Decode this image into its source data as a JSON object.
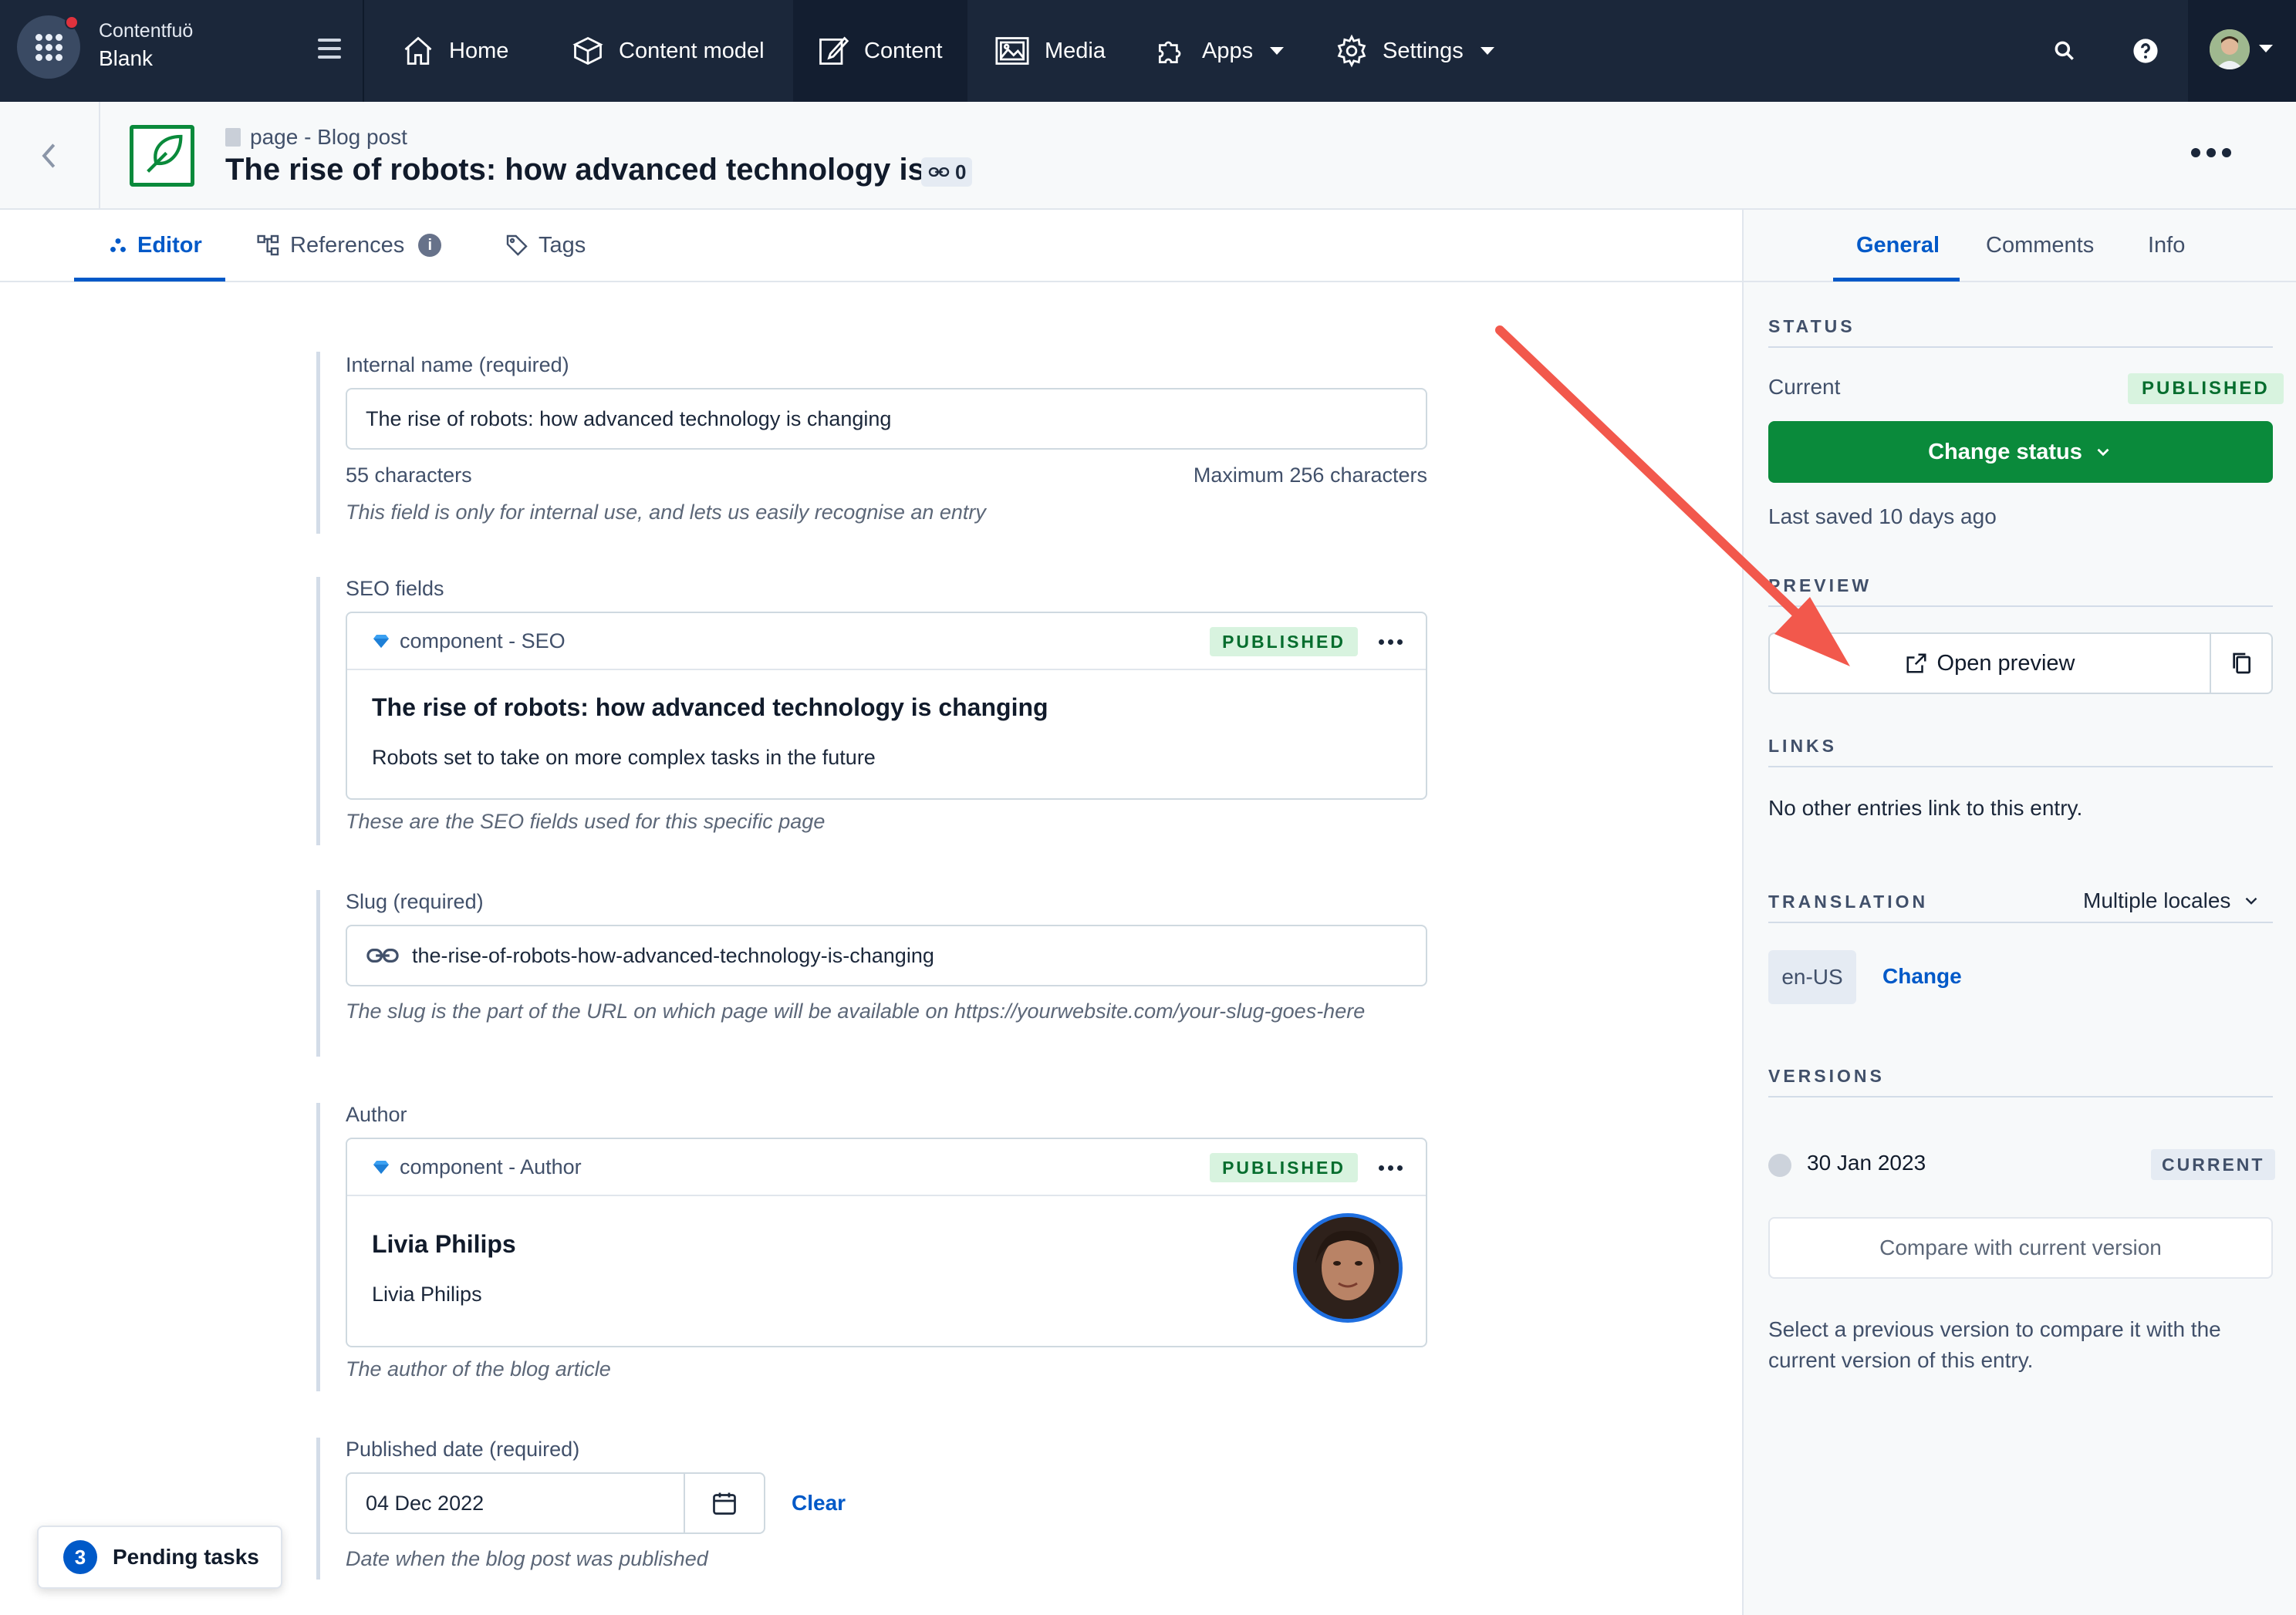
{
  "topnav": {
    "space_org": "Contentfuö",
    "space_env": "Blank",
    "items": [
      {
        "label": "Home",
        "icon": "home-icon"
      },
      {
        "label": "Content model",
        "icon": "content-model-icon"
      },
      {
        "label": "Content",
        "icon": "content-edit-icon",
        "active": true
      },
      {
        "label": "Media",
        "icon": "media-icon"
      },
      {
        "label": "Apps",
        "icon": "puzzle-icon"
      },
      {
        "label": "Settings",
        "icon": "gear-icon"
      }
    ]
  },
  "entry": {
    "content_type": "page - Blog post",
    "title": "The rise of robots: how advanced technology is...",
    "link_count": "0"
  },
  "tabs": [
    {
      "label": "Editor",
      "icon": "editor-icon",
      "active": true
    },
    {
      "label": "References",
      "icon": "references-icon"
    },
    {
      "label": "Tags",
      "icon": "tag-icon"
    }
  ],
  "fields": {
    "internal_name": {
      "label": "Internal name (required)",
      "value": "The rise of robots: how advanced technology is changing",
      "count": "55 characters",
      "max": "Maximum 256 characters",
      "help": "This field is only for internal use, and lets us easily recognise an entry"
    },
    "seo": {
      "label": "SEO fields",
      "ctype": "component - SEO",
      "status": "PUBLISHED",
      "title": "The rise of robots: how advanced technology is changing",
      "description": "Robots set to take on more complex tasks in the future",
      "help": "These are the SEO fields used for this specific page"
    },
    "slug": {
      "label": "Slug (required)",
      "value": "the-rise-of-robots-how-advanced-technology-is-changing",
      "help": "The slug is the part of the URL on which page will be available on https://yourwebsite.com/your-slug-goes-here"
    },
    "author": {
      "label": "Author",
      "ctype": "component - Author",
      "status": "PUBLISHED",
      "name": "Livia Philips",
      "subname": "Livia Philips",
      "help": "The author of the blog article"
    },
    "published_date": {
      "label": "Published date (required)",
      "value": "04 Dec 2022",
      "clear": "Clear",
      "help": "Date when the blog post was published"
    }
  },
  "sidebar": {
    "tabs": [
      {
        "label": "General",
        "active": true
      },
      {
        "label": "Comments"
      },
      {
        "label": "Info"
      }
    ],
    "status_heading": "STATUS",
    "current_label": "Current",
    "status_badge": "PUBLISHED",
    "change_status": "Change status",
    "last_saved": "Last saved 10 days ago",
    "preview_heading": "PREVIEW",
    "open_preview": "Open preview",
    "links_heading": "LINKS",
    "links_text": "No other entries link to this entry.",
    "translation_heading": "TRANSLATION",
    "translation_select": "Multiple locales",
    "locale": "en-US",
    "locale_change": "Change",
    "versions_heading": "VERSIONS",
    "version_date": "30 Jan 2023",
    "version_badge": "CURRENT",
    "compare_button": "Compare with current version",
    "versions_help": "Select a previous version to compare it with the current version of this entry."
  },
  "pending_tasks": {
    "count": "3",
    "label": "Pending tasks"
  },
  "colors": {
    "nav_bg": "#1b273a",
    "primary_blue": "#0059c8",
    "publish_green": "#0a8a3b",
    "annotation_arrow": "#f2584c"
  }
}
